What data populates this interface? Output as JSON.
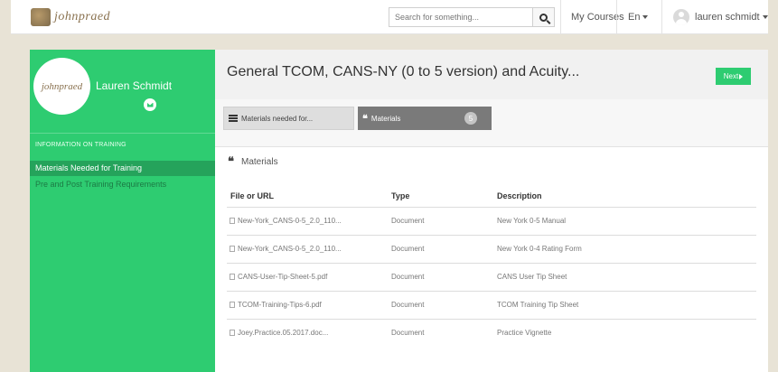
{
  "topbar": {
    "logo_text": "johnpraed",
    "search_placeholder": "Search for something...",
    "my_courses": "My Courses",
    "language": "En",
    "user_name": "lauren schmidt"
  },
  "sidebar": {
    "profile_name": "Lauren Schmidt",
    "profile_logo_text": "johnpraed",
    "heading": "INFORMATION ON TRAINING",
    "items": [
      {
        "label": "Materials Needed for Training",
        "active": true
      },
      {
        "label": "Pre and Post Training Requirements",
        "active": false
      }
    ],
    "accent": "#2ecc71"
  },
  "main": {
    "title": "General TCOM, CANS-NY (0 to 5 version) and Acuity...",
    "next_label": "Next",
    "tabs": [
      {
        "label": "Materials needed for...",
        "icon": "list-icon"
      },
      {
        "label": "Materials",
        "icon": "quote-icon",
        "count": "5"
      }
    ],
    "section_title": "Materials",
    "columns": [
      "File or URL",
      "Type",
      "Description"
    ],
    "rows": [
      {
        "file": "New-York_CANS-0-5_2.0_110...",
        "type": "Document",
        "description": "New York 0-5 Manual"
      },
      {
        "file": "New-York_CANS-0-5_2.0_110...",
        "type": "Document",
        "description": "New York 0-4 Rating Form"
      },
      {
        "file": "CANS-User-Tip-Sheet-5.pdf",
        "type": "Document",
        "description": "CANS User Tip Sheet"
      },
      {
        "file": "TCOM-Training-Tips-6.pdf",
        "type": "Document",
        "description": "TCOM Training Tip Sheet"
      },
      {
        "file": "Joey.Practice.05.2017.doc...",
        "type": "Document",
        "description": "Practice Vignette"
      }
    ]
  }
}
